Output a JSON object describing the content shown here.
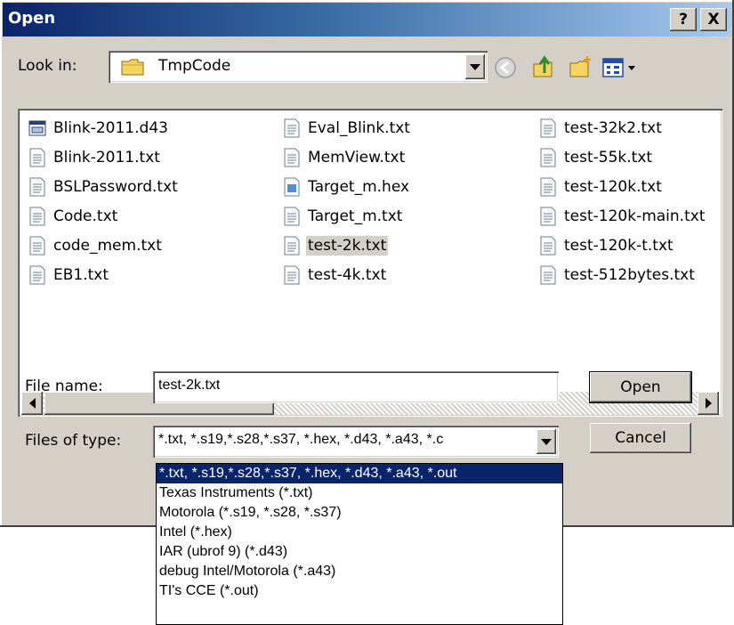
{
  "window": {
    "title": "Open",
    "help_label": "?",
    "close_label": "X"
  },
  "lookin": {
    "label": "Look in:",
    "value": "TmpCode"
  },
  "toolbar_icons": [
    "back-icon",
    "up-folder-icon",
    "new-folder-icon",
    "view-menu-icon"
  ],
  "files": {
    "columns": [
      [
        {
          "name": "Blink-2011.d43",
          "icon": "binary-file-icon"
        },
        {
          "name": "Blink-2011.txt",
          "icon": "text-file-icon"
        },
        {
          "name": "BSLPassword.txt",
          "icon": "text-file-icon"
        },
        {
          "name": "Code.txt",
          "icon": "text-file-icon"
        },
        {
          "name": "code_mem.txt",
          "icon": "text-file-icon"
        },
        {
          "name": "EB1.txt",
          "icon": "text-file-icon"
        }
      ],
      [
        {
          "name": "Eval_Blink.txt",
          "icon": "text-file-icon"
        },
        {
          "name": "MemView.txt",
          "icon": "text-file-icon"
        },
        {
          "name": "Target_m.hex",
          "icon": "hex-file-icon"
        },
        {
          "name": "Target_m.txt",
          "icon": "text-file-icon"
        },
        {
          "name": "test-2k.txt",
          "icon": "text-file-icon",
          "selected": true
        },
        {
          "name": "test-4k.txt",
          "icon": "text-file-icon"
        }
      ],
      [
        {
          "name": "test-32k2.txt",
          "icon": "text-file-icon"
        },
        {
          "name": "test-55k.txt",
          "icon": "text-file-icon"
        },
        {
          "name": "test-120k.txt",
          "icon": "text-file-icon"
        },
        {
          "name": "test-120k-main.txt",
          "icon": "text-file-icon"
        },
        {
          "name": "test-120k-t.txt",
          "icon": "text-file-icon"
        },
        {
          "name": "test-512bytes.txt",
          "icon": "text-file-icon"
        }
      ]
    ]
  },
  "filename": {
    "label": "File name:",
    "value": "test-2k.txt"
  },
  "filetype": {
    "label": "Files of type:",
    "value": "*.txt, *.s19,*.s28,*.s37, *.hex, *.d43, *.a43, *.c",
    "options": [
      "*.txt, *.s19,*.s28,*.s37, *.hex, *.d43, *.a43, *.out",
      "Texas Instruments (*.txt)",
      "Motorola  (*.s19, *.s28, *.s37)",
      "Intel  (*.hex)",
      "IAR (ubrof 9)  (*.d43)",
      "debug Intel/Motorola  (*.a43)",
      "TI's CCE (*.out)"
    ],
    "selected_index": 0
  },
  "buttons": {
    "open": "Open",
    "cancel": "Cancel"
  },
  "colors": {
    "title_start": "#0a246a",
    "title_end": "#a6caf0",
    "face": "#d4d0c8",
    "highlight": "#0a246a"
  }
}
